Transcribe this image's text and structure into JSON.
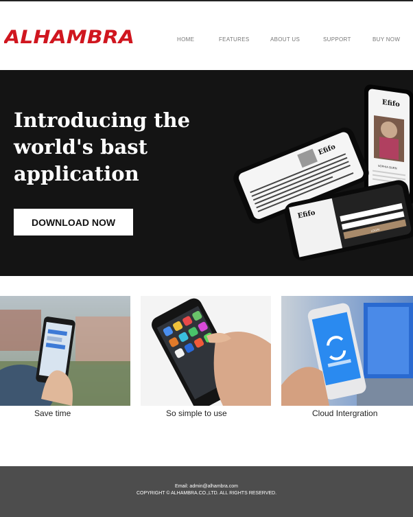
{
  "brand": {
    "logo_text": "ALHAMBRA",
    "accent": "#d0161f"
  },
  "nav": {
    "items": [
      {
        "label": "HOME"
      },
      {
        "label": "FEATURES"
      },
      {
        "label": "ABOUT US"
      },
      {
        "label": "SUPPORT"
      },
      {
        "label": "BUY NOW"
      }
    ]
  },
  "hero": {
    "title_lines": [
      "Introducing the",
      "world's bast",
      "application"
    ],
    "button_label": "DOWNLOAD NOW",
    "mockup_text": {
      "app_name": "Efifo",
      "login_label": "LOGIN",
      "user_name": "SOPHIA BURN"
    },
    "colors": {
      "background": "#141414"
    }
  },
  "features": [
    {
      "label": "Save time",
      "image": "hand holding phone with chat app outdoors"
    },
    {
      "label": "So simple to use",
      "image": "hand tapping phone home screen icons"
    },
    {
      "label": "Cloud Intergration",
      "image": "hand holding phone with sync icon near laptop"
    }
  ],
  "footer": {
    "email": "Email: admin@alhambra.com",
    "copyright": "COPYRIGHT © ALHAMBRA.CO.,LTD. ALL RIGHTS RESERVED.",
    "background": "#4d4d4d"
  }
}
